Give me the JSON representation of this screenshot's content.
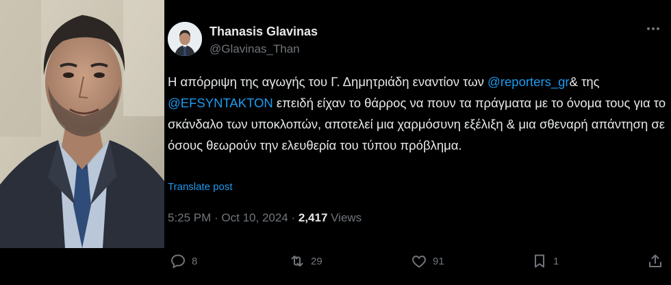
{
  "author": {
    "name": "Thanasis Glavinas",
    "handle": "@Glavinas_Than"
  },
  "post": {
    "text_1": "Η απόρριψη της αγωγής του Γ. Δημητριάδη εναντίον των ",
    "mention_1": "@reporters_gr",
    "text_2": "& της ",
    "mention_2": "@EFSYNTAKTON",
    "text_3": " επειδή είχαν το θάρρος να πουν τα πράγματα με το όνομα τους για το σκάνδαλο των υποκλοπών, αποτελεί μια χαρμόσυνη εξέλιξη & μια σθεναρή απάντηση σε όσους θεωρούν την ελευθερία του τύπου πρόβλημα.",
    "translate_label": "Translate post"
  },
  "meta": {
    "time": "5:25 PM",
    "sep1": " · ",
    "date": "Oct 10, 2024",
    "sep2": " · ",
    "views_count": "2,417",
    "views_label": " Views"
  },
  "actions": {
    "replies": "8",
    "reposts": "29",
    "likes": "91",
    "bookmarks": "1"
  },
  "icons": {
    "reply": "speech-bubble-icon",
    "repost": "repost-arrows-icon",
    "like": "heart-icon",
    "bookmark": "bookmark-icon",
    "share": "share-upload-icon",
    "more": "more-dots-icon"
  },
  "colors": {
    "background": "#000000",
    "text": "#e7e9ea",
    "muted": "#71767b",
    "accent": "#1d9bf0"
  }
}
